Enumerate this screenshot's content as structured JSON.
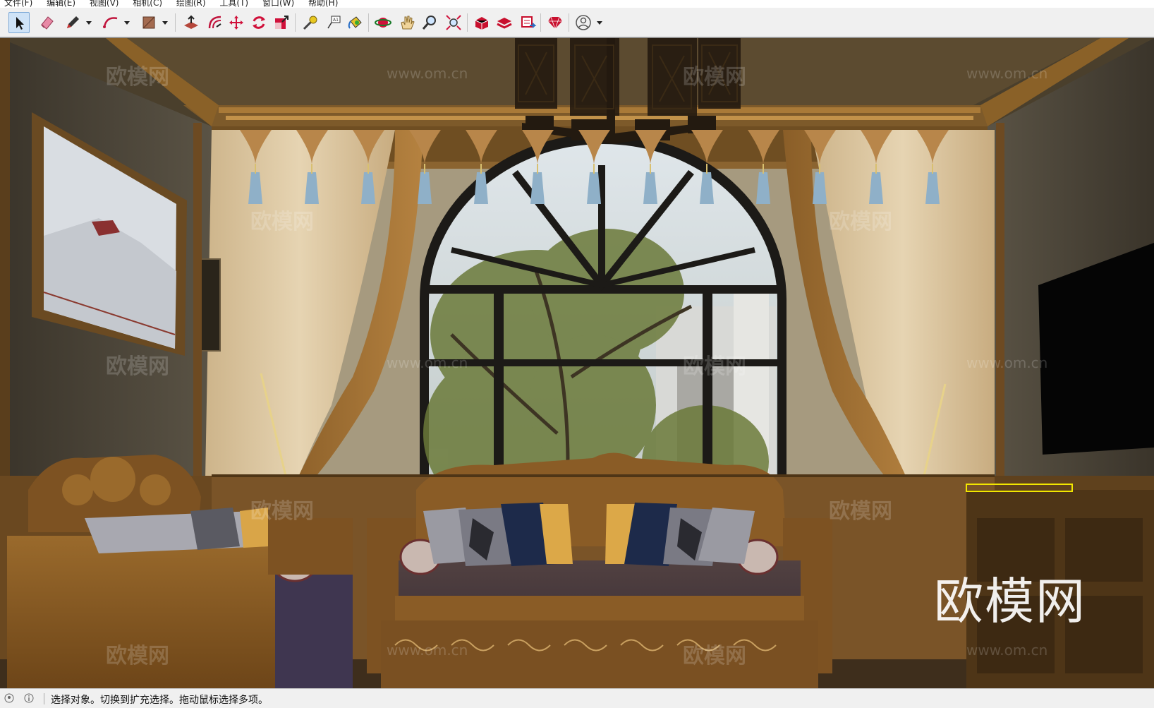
{
  "menu": {
    "items": [
      "文件(F)",
      "编辑(E)",
      "视图(V)",
      "相机(C)",
      "绘图(R)",
      "工具(T)",
      "窗口(W)",
      "帮助(H)"
    ]
  },
  "toolbar": {
    "tools": [
      {
        "name": "select-tool",
        "icon": "arrow-cursor-icon",
        "active": true
      },
      {
        "name": "eraser-tool",
        "icon": "eraser-icon"
      },
      {
        "name": "line-tool",
        "icon": "pencil-icon",
        "dropdown": true
      },
      {
        "name": "arc-tool",
        "icon": "arc-icon",
        "dropdown": true
      },
      {
        "name": "rectangle-tool",
        "icon": "rectangle-icon",
        "dropdown": true
      },
      {
        "name": "push-pull-tool",
        "icon": "push-pull-icon"
      },
      {
        "name": "offset-tool",
        "icon": "offset-icon"
      },
      {
        "name": "move-tool",
        "icon": "move-icon"
      },
      {
        "name": "rotate-tool",
        "icon": "rotate-icon"
      },
      {
        "name": "scale-tool",
        "icon": "scale-icon"
      },
      {
        "name": "tape-measure-tool",
        "icon": "tape-measure-icon"
      },
      {
        "name": "text-tool",
        "icon": "text-icon"
      },
      {
        "name": "paint-bucket-tool",
        "icon": "paint-bucket-icon"
      },
      {
        "name": "orbit-tool",
        "icon": "orbit-icon"
      },
      {
        "name": "pan-tool",
        "icon": "hand-icon"
      },
      {
        "name": "zoom-tool",
        "icon": "magnifier-icon"
      },
      {
        "name": "zoom-extents-tool",
        "icon": "zoom-extents-icon"
      },
      {
        "name": "3d-warehouse",
        "icon": "warehouse-icon"
      },
      {
        "name": "extension-warehouse",
        "icon": "extension-warehouse-icon"
      },
      {
        "name": "layout-send",
        "icon": "layout-icon"
      },
      {
        "name": "ruby-extension",
        "icon": "ruby-icon"
      },
      {
        "name": "account",
        "icon": "user-account-icon",
        "dropdown": true
      }
    ]
  },
  "viewport": {
    "watermark_text": "欧模网",
    "watermark_url": "www.om.cn",
    "colors": {
      "wood": "#8b5a22",
      "wall": "#2e2c27",
      "curtain": "#d8c3a0",
      "window_frame": "#1c1a17"
    }
  },
  "status": {
    "message": "选择对象。切换到扩充选择。拖动鼠标选择多项。"
  }
}
